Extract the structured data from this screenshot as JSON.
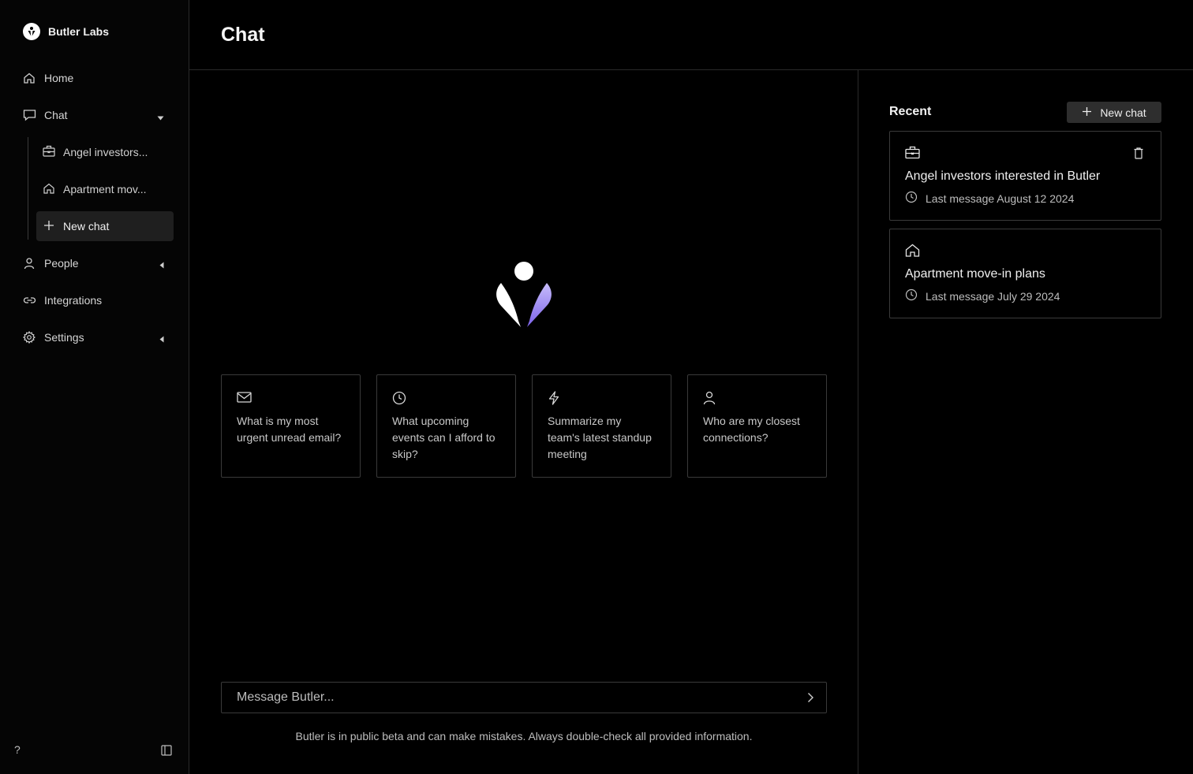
{
  "brand": {
    "name": "Butler Labs"
  },
  "sidebar": {
    "items": [
      {
        "label": "Home",
        "icon": "home-icon"
      },
      {
        "label": "Chat",
        "icon": "chat-icon",
        "caret": "down"
      },
      {
        "label": "People",
        "icon": "person-icon",
        "caret": "left"
      },
      {
        "label": "Integrations",
        "icon": "link-icon"
      },
      {
        "label": "Settings",
        "icon": "gear-icon",
        "caret": "left"
      }
    ],
    "chat_subitems": [
      {
        "label": "Angel investors...",
        "icon": "briefcase-icon"
      },
      {
        "label": "Apartment mov...",
        "icon": "home-icon"
      },
      {
        "label": "New chat",
        "icon": "plus-icon",
        "active": true
      }
    ],
    "help_label": "?"
  },
  "header": {
    "title": "Chat"
  },
  "suggestions": [
    {
      "icon": "mail-icon",
      "text": "What is my most urgent unread email?"
    },
    {
      "icon": "clock-icon",
      "text": "What upcoming events can I afford to skip?"
    },
    {
      "icon": "lightning-icon",
      "text": "Summarize my team's latest standup meeting"
    },
    {
      "icon": "person-icon",
      "text": "Who are my closest connections?"
    }
  ],
  "message": {
    "placeholder": "Message Butler...",
    "disclaimer": "Butler is in public beta and can make mistakes. Always double-check all provided information."
  },
  "recent": {
    "title": "Recent",
    "new_chat_label": "New chat",
    "chats": [
      {
        "icon": "briefcase-icon",
        "title": "Angel investors interested in Butler",
        "meta": "Last message August 12 2024"
      },
      {
        "icon": "home-icon",
        "title": "Apartment move-in plans",
        "meta": "Last message July 29 2024"
      }
    ]
  },
  "colors": {
    "background": "#000000",
    "accent": "#8b7cf6",
    "border": "#3a3a3a"
  }
}
